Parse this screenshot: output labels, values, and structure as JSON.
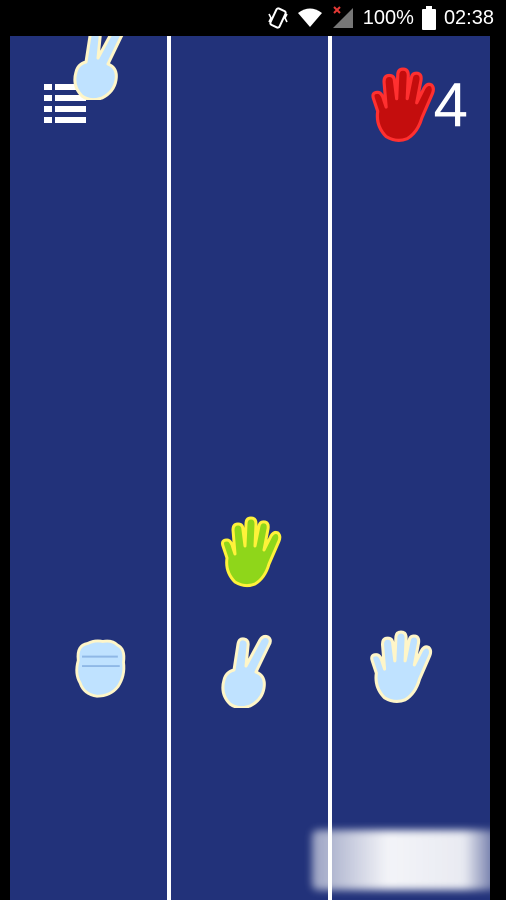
{
  "status_bar": {
    "battery_percent": "100%",
    "time": "02:38",
    "icons": [
      "vibrate-icon",
      "wifi-icon",
      "signal-icon",
      "battery-icon"
    ]
  },
  "game": {
    "score": "4",
    "target_gesture": "paper",
    "target_color": "#d20f0f",
    "field_color": "#22327a",
    "lanes": 3,
    "falling": [
      {
        "gesture": "scissors",
        "lane": 1,
        "color": "#bfe2ff"
      },
      {
        "gesture": "paper",
        "lane": 2,
        "color": "#8fd61a"
      }
    ],
    "choices": [
      {
        "gesture": "rock",
        "lane": 1
      },
      {
        "gesture": "scissors",
        "lane": 2
      },
      {
        "gesture": "paper",
        "lane": 3
      }
    ]
  }
}
